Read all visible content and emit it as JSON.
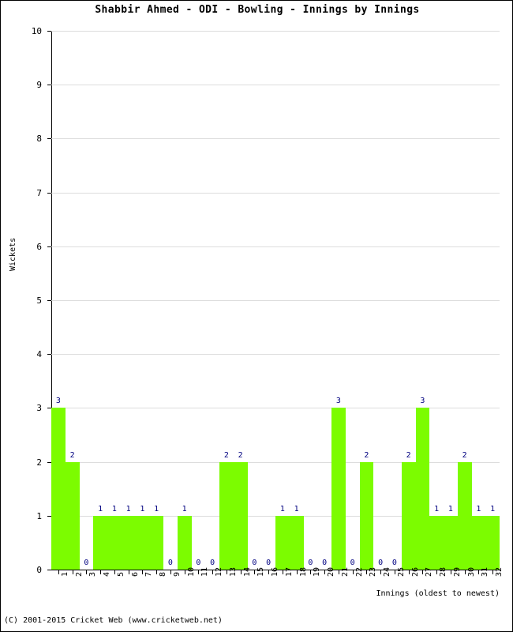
{
  "chart_data": {
    "type": "bar",
    "title": "Shabbir Ahmed - ODI - Bowling - Innings by Innings",
    "xlabel": "Innings (oldest to newest)",
    "ylabel": "Wickets",
    "categories": [
      "1",
      "2",
      "3",
      "4",
      "5",
      "6",
      "7",
      "8",
      "9",
      "10",
      "11",
      "12",
      "13",
      "14",
      "15",
      "16",
      "17",
      "18",
      "19",
      "20",
      "21",
      "22",
      "23",
      "24",
      "25",
      "26",
      "27",
      "28",
      "29",
      "30",
      "31",
      "32"
    ],
    "values": [
      3,
      2,
      0,
      1,
      1,
      1,
      1,
      1,
      0,
      1,
      0,
      0,
      2,
      2,
      0,
      0,
      1,
      1,
      0,
      0,
      3,
      0,
      2,
      0,
      0,
      2,
      3,
      1,
      1,
      2,
      1,
      1
    ],
    "data_labels": [
      "3",
      "2",
      "0",
      "1",
      "1",
      "1",
      "1",
      "1",
      "0",
      "1",
      "0",
      "0",
      "2",
      "2",
      "0",
      "0",
      "1",
      "1",
      "0",
      "0",
      "3",
      "0",
      "2",
      "0",
      "0",
      "2",
      "3",
      "1",
      "1",
      "2",
      "1",
      "1"
    ],
    "ylim": [
      0,
      10
    ],
    "y_ticks": [
      "0",
      "1",
      "2",
      "3",
      "4",
      "5",
      "6",
      "7",
      "8",
      "9",
      "10"
    ],
    "grid": true,
    "legend": "none",
    "bar_color": "#7CFC00",
    "label_color": "#000080",
    "gridline_color": "#DDDDDD",
    "axis_color": "#000000"
  },
  "footer": {
    "copyright": "(C) 2001-2015 Cricket Web (www.cricketweb.net)"
  }
}
